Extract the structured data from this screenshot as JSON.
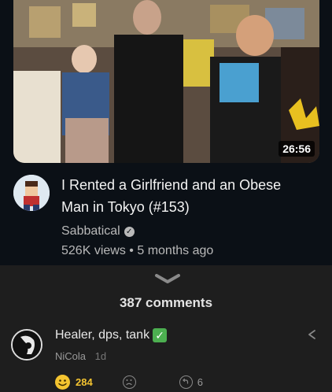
{
  "video": {
    "duration": "26:56",
    "title": "I Rented a Girlfriend and an Obese Man in Tokyo (#153)",
    "channel": "Sabbatical",
    "views": "526K views",
    "separator": "•",
    "age": "5 months ago"
  },
  "comments": {
    "count_label": "387 comments",
    "items": [
      {
        "text": "Healer, dps, tank",
        "author": "NiCola",
        "time": "1d",
        "likes": "284",
        "replies": "6"
      }
    ]
  },
  "colors": {
    "top_background": "#0b1016",
    "panel_background": "#1e1e1e",
    "like_accent": "#f4c430",
    "check_green": "#4caf50"
  }
}
